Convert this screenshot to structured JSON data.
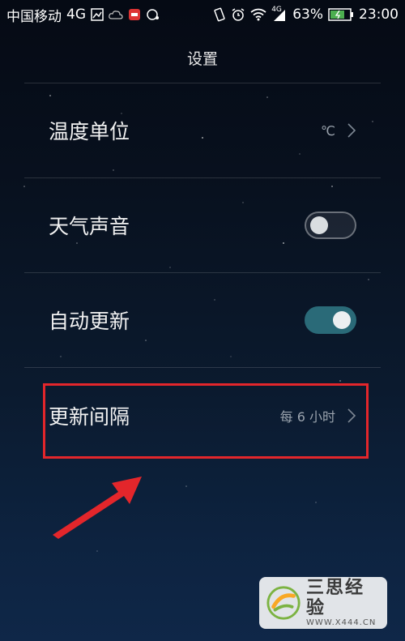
{
  "status_bar": {
    "carrier": "中国移动",
    "network": "4G",
    "signal_badge": "4G",
    "battery": "63%",
    "time": "23:00"
  },
  "header": {
    "title": "设置"
  },
  "settings": {
    "temperature_unit": {
      "label": "温度单位",
      "value": "℃"
    },
    "weather_sound": {
      "label": "天气声音",
      "state": "off"
    },
    "auto_update": {
      "label": "自动更新",
      "state": "on"
    },
    "update_interval": {
      "label": "更新间隔",
      "value": "每 6 小时"
    }
  },
  "colors": {
    "accent_toggle": "#2a6a78",
    "highlight_box": "#e3262b",
    "arrow": "#e3262b"
  },
  "watermark": {
    "name": "三思经验",
    "url": "WWW.X444.CN"
  }
}
